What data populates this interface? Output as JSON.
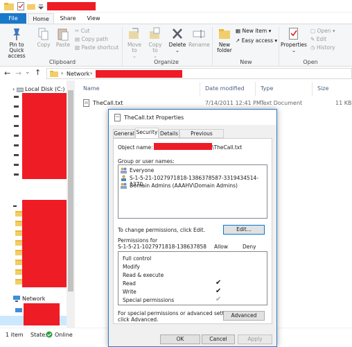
{
  "explorer": {
    "tabs": [
      "File",
      "Home",
      "Share",
      "View"
    ],
    "ribbon": {
      "clipboard": {
        "pin_label": "Pin to Quick access",
        "copy_label": "Copy",
        "paste_label": "Paste",
        "cut_label": "Cut",
        "copy_path_label": "Copy path",
        "paste_shortcut_label": "Paste shortcut",
        "group_label": "Clipboard"
      },
      "organize": {
        "move_to_label": "Move to",
        "copy_to_label": "Copy to",
        "delete_label": "Delete",
        "rename_label": "Rename",
        "group_label": "Organize"
      },
      "new": {
        "new_folder_label": "New folder",
        "new_item_label": "New item",
        "easy_access_label": "Easy access",
        "group_label": "New"
      },
      "open": {
        "properties_label": "Properties",
        "open_label": "Open",
        "edit_label": "Edit",
        "history_label": "History",
        "group_label": "Open"
      }
    },
    "address": {
      "segment": "Network"
    },
    "nav": {
      "local_disk": "Local Disk (C:)",
      "network": "Network"
    },
    "columns": [
      "Name",
      "Date modified",
      "Type",
      "Size"
    ],
    "files": [
      {
        "name": "TheCall.txt",
        "date": "7/14/2011 12:41 PM",
        "type": "Text Document",
        "size": "11 KB"
      }
    ],
    "status": {
      "count": "1 item",
      "state_label": "State:",
      "state_value": "Online"
    }
  },
  "dialog": {
    "title": "TheCall.txt Properties",
    "tabs": [
      "General",
      "Security",
      "Details",
      "Previous Versions"
    ],
    "object_name_label": "Object name:",
    "object_name_suffix": "\\TheCall.txt",
    "groups_label": "Group or user names:",
    "groups": [
      "Everyone",
      "S-1-5-21-1027971818-1386378587-3319434514-1370",
      "Domain Admins (AAAHV\\Domain Admins)"
    ],
    "change_text": "To change permissions, click Edit.",
    "edit_button": "Edit...",
    "permissions_for": "Permissions for",
    "permissions_sid": "S-1-5-21-1027971818-138637858",
    "allow_label": "Allow",
    "deny_label": "Deny",
    "permissions": [
      {
        "name": "Full control",
        "allow": false,
        "deny": false
      },
      {
        "name": "Modify",
        "allow": false,
        "deny": false
      },
      {
        "name": "Read & execute",
        "allow": false,
        "deny": false
      },
      {
        "name": "Read",
        "allow": true,
        "deny": false
      },
      {
        "name": "Write",
        "allow": true,
        "deny": false
      },
      {
        "name": "Special permissions",
        "allow": true,
        "allow_inherited": true,
        "deny": false
      }
    ],
    "advanced_text_1": "For special permissions or advanced settings,",
    "advanced_text_2": "click Advanced.",
    "advanced_button": "Advanced",
    "ok_button": "OK",
    "cancel_button": "Cancel",
    "apply_button": "Apply",
    "check_glyph": "✔"
  },
  "colors": {
    "accent": "#1979ca",
    "redaction": "#ee1c25",
    "folder": "#f2ce6b"
  }
}
